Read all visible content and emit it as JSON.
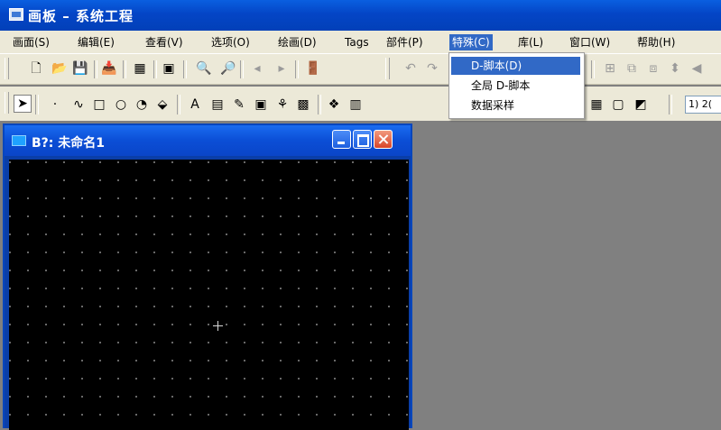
{
  "window": {
    "title": "画板 – 系统工程",
    "icon": "canvas-app-icon"
  },
  "menubar": {
    "items": [
      {
        "label": "画面(S)"
      },
      {
        "label": "编辑(E)"
      },
      {
        "label": "查看(V)"
      },
      {
        "label": "选项(O)"
      },
      {
        "label": "绘画(D)"
      },
      {
        "label": "Tags"
      },
      {
        "label": "部件(P)"
      },
      {
        "label": "特殊(C)",
        "active": true
      },
      {
        "label": "库(L)"
      },
      {
        "label": "窗口(W)"
      },
      {
        "label": "帮助(H)"
      }
    ]
  },
  "dropdown": {
    "items": [
      {
        "label": "D-脚本(D)",
        "highlighted": true
      },
      {
        "label": "全局 D-脚本"
      },
      {
        "label": "数据采样"
      }
    ]
  },
  "toolbar2": {
    "zoom_value": "1) 2("
  },
  "child_window": {
    "title": "B?: 未命名1",
    "icon": "window-icon"
  },
  "colors": {
    "title_bar": "#0445c6",
    "menu_highlight": "#3169c6",
    "canvas": "#000000",
    "workspace": "#808080",
    "chrome": "#ece9d8"
  }
}
